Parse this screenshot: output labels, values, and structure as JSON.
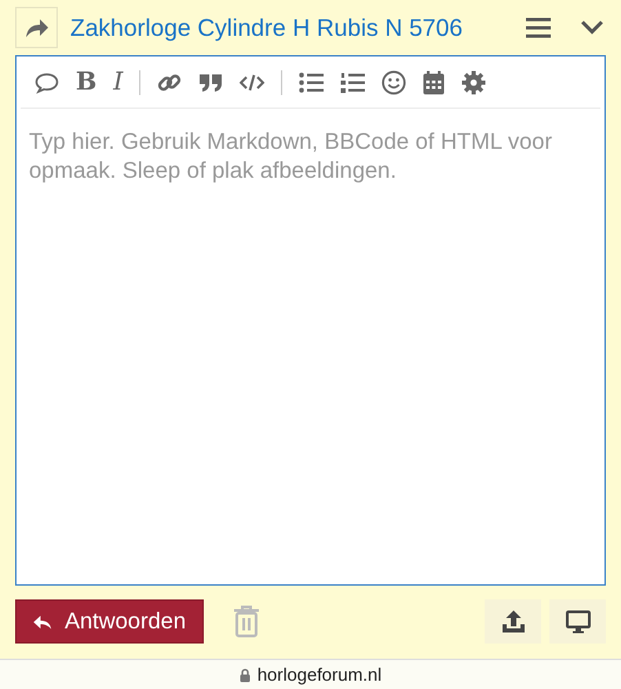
{
  "header": {
    "title": "Zakhorloge Cylindre H Rubis N 5706"
  },
  "toolbar": [
    {
      "kind": "bubble"
    },
    {
      "kind": "letter",
      "label": "B"
    },
    {
      "kind": "letter",
      "label": "I"
    },
    {
      "kind": "divider"
    },
    {
      "kind": "link"
    },
    {
      "kind": "quote"
    },
    {
      "kind": "code"
    },
    {
      "kind": "divider"
    },
    {
      "kind": "bullets"
    },
    {
      "kind": "numbers"
    },
    {
      "kind": "smiley"
    },
    {
      "kind": "calendar"
    },
    {
      "kind": "gear"
    }
  ],
  "editor": {
    "placeholder": "Typ hier. Gebruik Markdown, BBCode of HTML voor opmaak. Sleep of plak afbeeldingen."
  },
  "reply_button": {
    "label": "Antwoorden"
  },
  "address_bar": {
    "url": "horlogeforum.nl"
  }
}
